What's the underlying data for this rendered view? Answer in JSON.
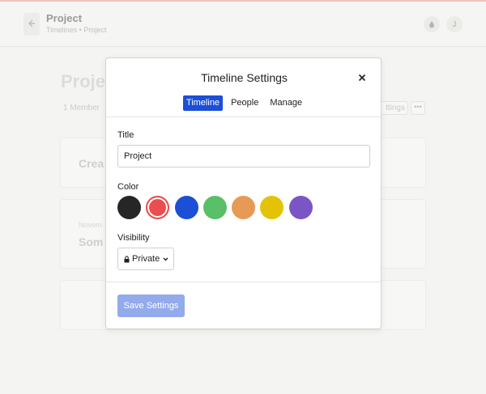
{
  "topbar": {
    "project_title": "Project",
    "breadcrumb": "Timelines • Project",
    "avatar_initial": "J"
  },
  "background": {
    "page_title": "Proje",
    "members": "1 Member",
    "settings_label": "ttings",
    "card1_title": "Crea",
    "card2_date": "Novem",
    "card2_title": "Som"
  },
  "modal": {
    "title": "Timeline Settings",
    "tabs": [
      {
        "label": "Timeline",
        "active": true
      },
      {
        "label": "People",
        "active": false
      },
      {
        "label": "Manage",
        "active": false
      }
    ],
    "title_field": {
      "label": "Title",
      "value": "Project"
    },
    "color_field": {
      "label": "Color",
      "options": [
        "#262626",
        "#ea4e4e",
        "#1c4fd6",
        "#59bf68",
        "#e69a56",
        "#e4c307",
        "#7c55c4"
      ],
      "selected_index": 1
    },
    "visibility_field": {
      "label": "Visibility",
      "value": "Private"
    },
    "save_label": "Save Settings"
  }
}
